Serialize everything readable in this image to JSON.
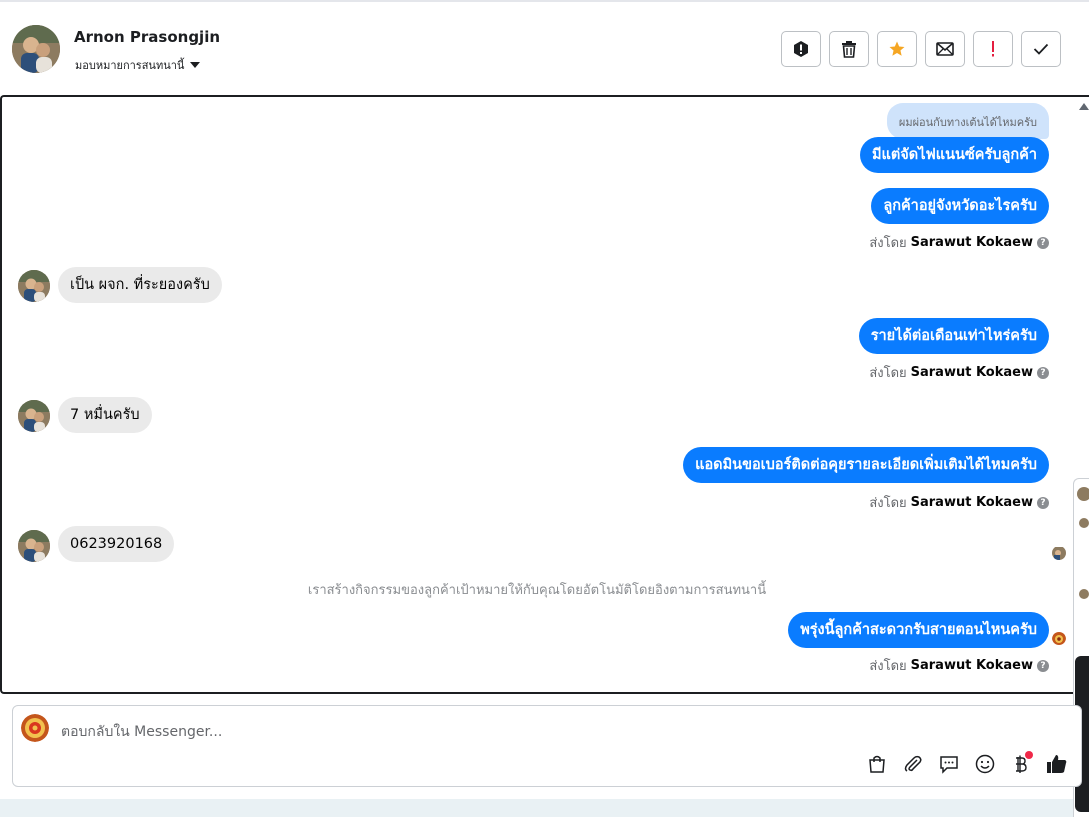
{
  "header": {
    "contact_name": "Arnon Prasongjin",
    "assign_label": "มอบหมายการสนทนานี้"
  },
  "actions": [
    {
      "name": "report-spam-button",
      "icon": "alert-circle-icon"
    },
    {
      "name": "delete-button",
      "icon": "trash-icon"
    },
    {
      "name": "star-button",
      "icon": "star-icon"
    },
    {
      "name": "mark-unread-button",
      "icon": "envelope-icon"
    },
    {
      "name": "mark-important-button",
      "icon": "exclamation-icon"
    },
    {
      "name": "mark-done-button",
      "icon": "checkmark-icon"
    }
  ],
  "messages": {
    "quote": "ผมผ่อนกับทางเต้นได้ไหมครับ",
    "m1": "มีแต่จัดไฟแนนซ์ครับลูกค้า",
    "m2": "ลูกค้าอยู่จังหวัดอะไรครับ",
    "m3": "เป็น ผจก. ที่ระยองครับ",
    "m4": "รายได้ต่อเดือนเท่าไหร่ครับ",
    "m5": "7 หมื่นครับ",
    "m6": "แอดมินขอเบอร์ติดต่อคุยรายละเอียดเพิ่มเติมได้ไหมครับ",
    "m7": "0623920168",
    "system": "เราสร้างกิจกรรมของลูกค้าเป้าหมายให้กับคุณโดยอัตโนมัติโดยอิงตามการสนทนานี้",
    "m8": "พรุ่งนี้ลูกค้าสะดวกรับสายตอนไหนครับ"
  },
  "sent_by": {
    "prefix": "ส่งโดย",
    "agent": "Sarawut Kokaew",
    "help": "?"
  },
  "composer": {
    "placeholder": "ตอบกลับใน Messenger..."
  },
  "colors": {
    "outgoing_bubble": "#0a7cff",
    "incoming_bubble": "#eaeaea",
    "star": "#f5a623",
    "important": "#e41e3f"
  }
}
